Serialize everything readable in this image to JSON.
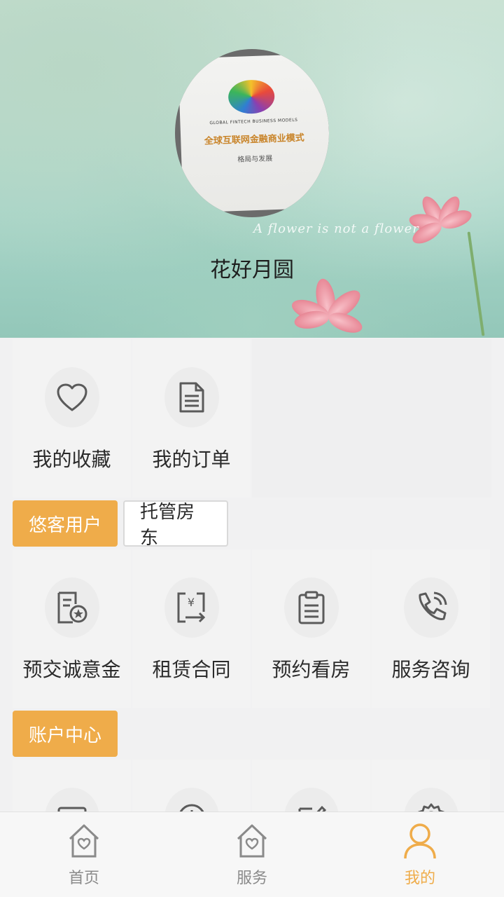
{
  "header": {
    "username": "花好月圆",
    "banner_script": "A flower is not a flower",
    "avatar_book": {
      "en_title": "GLOBAL FINTECH BUSINESS MODELS",
      "cn_title": "全球互联网金融商业模式",
      "cn_subtitle": "格局与发展"
    }
  },
  "top_items": [
    {
      "label": "我的收藏",
      "icon": "heart-icon"
    },
    {
      "label": "我的订单",
      "icon": "document-icon"
    }
  ],
  "tenant_tabs": [
    {
      "label": "悠客用户",
      "active": true
    },
    {
      "label": "托管房东",
      "active": false
    }
  ],
  "tenant_items": [
    {
      "label": "预交诚意金",
      "icon": "deposit-icon"
    },
    {
      "label": "租赁合同",
      "icon": "contract-yen-icon"
    },
    {
      "label": "预约看房",
      "icon": "clipboard-icon"
    },
    {
      "label": "服务咨询",
      "icon": "phone-icon"
    }
  ],
  "account_section": {
    "label": "账户中心"
  },
  "account_items": [
    {
      "icon": "wallet-icon"
    },
    {
      "icon": "info-icon"
    },
    {
      "icon": "edit-icon"
    },
    {
      "icon": "settings-icon"
    }
  ],
  "bottom_nav": [
    {
      "label": "首页",
      "icon": "home-heart-icon",
      "active": false
    },
    {
      "label": "服务",
      "icon": "service-house-icon",
      "active": false
    },
    {
      "label": "我的",
      "icon": "person-icon",
      "active": true
    }
  ],
  "colors": {
    "accent": "#efac4a",
    "icon_gray": "#5a5a5a"
  }
}
